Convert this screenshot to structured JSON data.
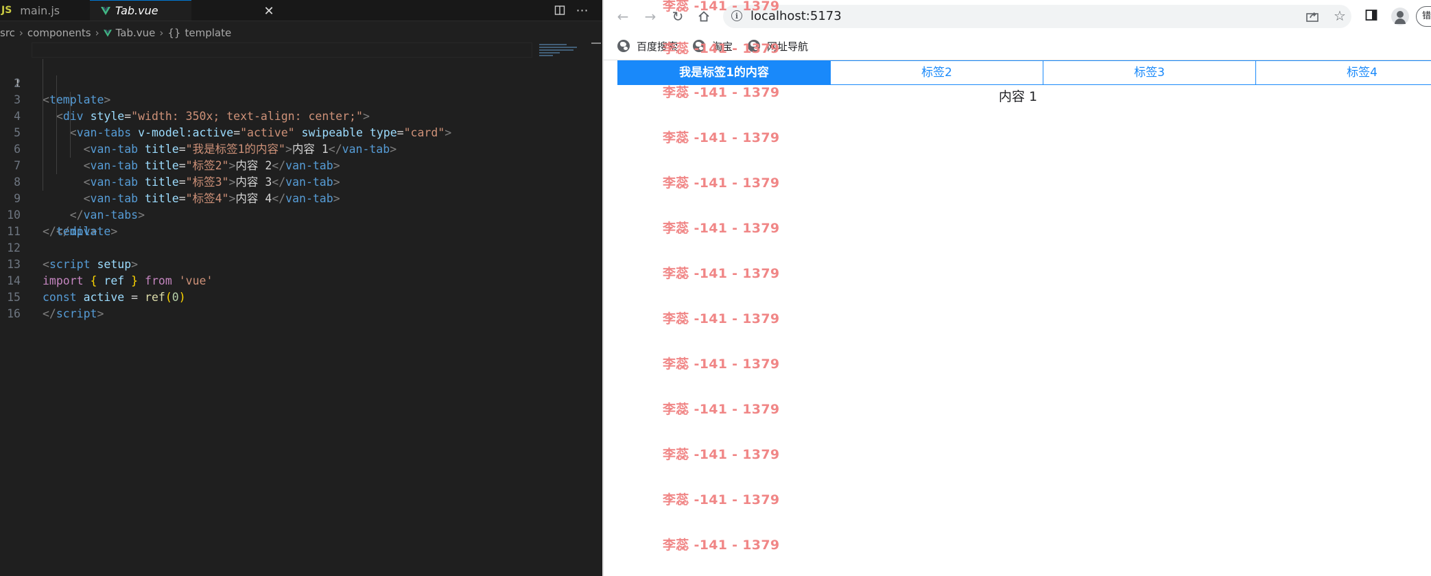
{
  "editor": {
    "tabs": [
      {
        "label": "main.js",
        "icon": "js-icon"
      },
      {
        "label": "Tab.vue",
        "icon": "vue-icon",
        "active": true
      }
    ],
    "tab_js_badge": "JS",
    "breadcrumb": [
      "src",
      "components",
      "Tab.vue",
      "template"
    ],
    "breadcrumb_symbol": "{}",
    "line_numbers": [
      "1",
      "2",
      "3",
      "4",
      "5",
      "6",
      "7",
      "8",
      "9",
      "10",
      "11",
      "12",
      "13",
      "14",
      "15",
      "16"
    ],
    "code": {
      "l1_tag": "template",
      "l2_tag": "div",
      "l2_attr": "style",
      "l2_val": "\"width: 350x; text-align: center;\"",
      "l3_tag": "van-tabs",
      "l3_attr1": "v-model:active",
      "l3_val1": "\"active\"",
      "l3_attr2": "swipeable",
      "l3_attr3": "type",
      "l3_val3": "\"card\"",
      "l4_val": "\"我是标签1的内容\"",
      "l4_text": "内容 1",
      "l5_val": "\"标签2\"",
      "l5_text": "内容 2",
      "l6_val": "\"标签3\"",
      "l6_text": "内容 3",
      "l7_val": "\"标签4\"",
      "l7_text": "内容 4",
      "tab_tag": "van-tab",
      "title_attr": "title",
      "l8_tag": "van-tabs",
      "l9_tag": "div",
      "l10_tag": "template",
      "l12_tag": "script",
      "l12_attr": "setup",
      "l13_kw": "import",
      "l13_ident": "ref",
      "l13_from": "from",
      "l13_str": "'vue'",
      "l14_kw": "const",
      "l14_var": "active",
      "l14_op": "=",
      "l14_fn": "ref",
      "l14_num": "0",
      "l15_tag": "script"
    }
  },
  "browser": {
    "url": "localhost:5173",
    "profile_button_text": "错",
    "bookmarks": [
      "百度搜索",
      "淘宝",
      "网址导航"
    ],
    "tabs": [
      {
        "title": "我是标签1的内容",
        "active": true
      },
      {
        "title": "标签2"
      },
      {
        "title": "标签3"
      },
      {
        "title": "标签4"
      }
    ],
    "panel_content": "内容 1",
    "watermark": "李蕊 -141 - 1379"
  },
  "colors": {
    "vant_primary": "#1989fa",
    "watermark": "#f08080",
    "editor_bg": "#1f1f1f"
  }
}
